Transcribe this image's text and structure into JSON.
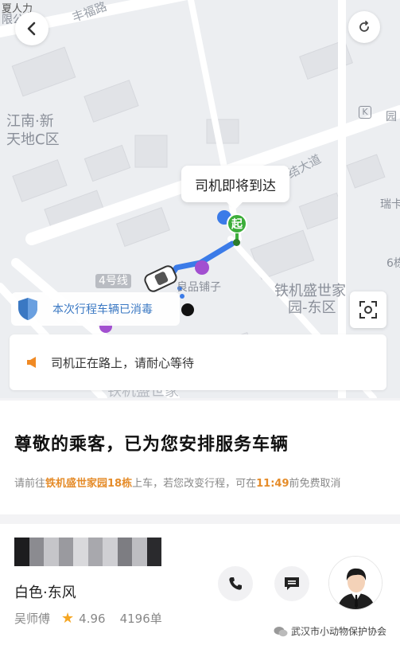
{
  "status_bar": {
    "left_partial": "夏人力",
    "second_partial": "限公",
    "road_partial": "丰福路"
  },
  "map": {
    "labels": {
      "district_line1": "江南·新",
      "district_line2": "天地C区",
      "road": "结大道",
      "metro": "4号线",
      "shop": "良品铺子",
      "community_line1": "铁机盛世家",
      "community_line2": "园-东区",
      "community_faded": "铁机盛世家",
      "edge_top": "园",
      "edge_mid": "瑞卡",
      "edge_low": "6栋",
      "metro_k": "K"
    },
    "bubble_text": "司机即将到达",
    "start_label": "起",
    "disinfect_text": "本次行程车辆已消毒",
    "notice_text": "司机正在路上，请耐心等待"
  },
  "service": {
    "title": "尊敬的乘客，已为您安排服务车辆",
    "line_prefix": "请前往",
    "location": "铁机盛世家园18栋",
    "line_mid": "上车，若您改变行程，可在",
    "cancel_time": "11:49",
    "line_suffix": "前免费取消"
  },
  "driver": {
    "car_model": "白色·东风",
    "name": "吴师傅",
    "rating": "4.96",
    "orders": "4196单"
  },
  "watermark": "武汉市小动物保护协会",
  "colors": {
    "route": "#3b7be8",
    "start_pin": "#3dae3b",
    "highlight": "#e58c2a",
    "disinfect_text": "#3a78c3",
    "star": "#f5a623"
  }
}
